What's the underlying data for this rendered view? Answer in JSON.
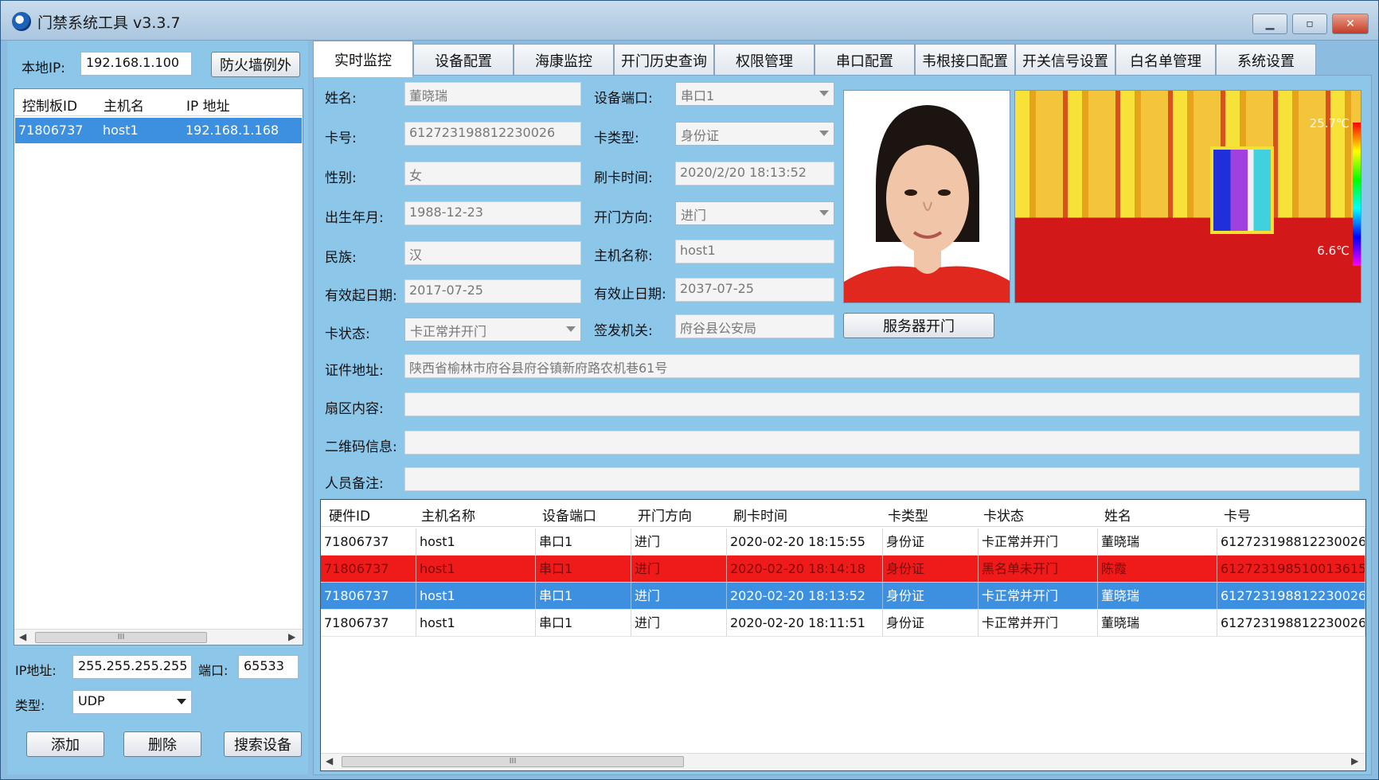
{
  "window": {
    "title": "门禁系统工具 v3.3.7",
    "minimize_icon": "minimize-icon",
    "maximize_icon": "maximize-icon",
    "close_icon": "close-icon"
  },
  "left": {
    "local_ip_label": "本地IP:",
    "local_ip_value": "192.168.1.100",
    "firewall_button": "防火墙例外",
    "device_list": {
      "headers": [
        "控制板ID",
        "主机名",
        "IP 地址"
      ],
      "rows": [
        {
          "id": "71806737",
          "host": "host1",
          "ip": "192.168.1.168"
        }
      ]
    },
    "ip_label": "IP地址:",
    "ip_value": "255.255.255.255",
    "port_label": "端口:",
    "port_value": "65533",
    "type_label": "类型:",
    "type_value": "UDP",
    "add_button": "添加",
    "delete_button": "删除",
    "search_button": "搜索设备"
  },
  "tabs": [
    "实时监控",
    "设备配置",
    "海康监控",
    "开门历史查询",
    "权限管理",
    "串口配置",
    "韦根接口配置",
    "开关信号设置",
    "白名单管理",
    "系统设置"
  ],
  "active_tab": "实时监控",
  "form": {
    "name_label": "姓名:",
    "name_value": "董晓瑞",
    "device_port_label": "设备端口:",
    "device_port_value": "串口1",
    "card_label": "卡号:",
    "card_value": "612723198812230026",
    "card_type_label": "卡类型:",
    "card_type_value": "身份证",
    "gender_label": "性别:",
    "gender_value": "女",
    "swipe_time_label": "刷卡时间:",
    "swipe_time_value": "2020/2/20 18:13:52",
    "birth_label": "出生年月:",
    "birth_value": "1988-12-23",
    "direction_label": "开门方向:",
    "direction_value": "进门",
    "ethnic_label": "民族:",
    "ethnic_value": "汉",
    "host_label": "主机名称:",
    "host_value": "host1",
    "valid_from_label": "有效起日期:",
    "valid_from_value": "2017-07-25",
    "valid_to_label": "有效止日期:",
    "valid_to_value": "2037-07-25",
    "card_status_label": "卡状态:",
    "card_status_value": "卡正常并开门",
    "issuer_label": "签发机关:",
    "issuer_value": "府谷县公安局",
    "server_open_button": "服务器开门",
    "address_label": "证件地址:",
    "address_value": "陕西省榆林市府谷县府谷镇新府路农机巷61号",
    "sector_label": "扇区内容:",
    "sector_value": "",
    "qr_label": "二维码信息:",
    "qr_value": "",
    "note_label": "人员备注:",
    "note_value": ""
  },
  "thermal": {
    "max_temp": "25.7℃",
    "min_temp": "6.6℃"
  },
  "records": {
    "headers": [
      "硬件ID",
      "主机名称",
      "设备端口",
      "开门方向",
      "刷卡时间",
      "卡类型",
      "卡状态",
      "姓名",
      "卡号"
    ],
    "rows": [
      {
        "hw": "71806737",
        "host": "host1",
        "port": "串口1",
        "dir": "进门",
        "time": "2020-02-20 18:15:55",
        "type": "身份证",
        "status": "卡正常并开门",
        "name": "董晓瑞",
        "card": "612723198812230026"
      },
      {
        "hw": "71806737",
        "host": "host1",
        "port": "串口1",
        "dir": "进门",
        "time": "2020-02-20 18:14:18",
        "type": "身份证",
        "status": "黑名单未开门",
        "name": "陈霞",
        "card": "612723198510013615"
      },
      {
        "hw": "71806737",
        "host": "host1",
        "port": "串口1",
        "dir": "进门",
        "time": "2020-02-20 18:13:52",
        "type": "身份证",
        "status": "卡正常并开门",
        "name": "董晓瑞",
        "card": "612723198812230026"
      },
      {
        "hw": "71806737",
        "host": "host1",
        "port": "串口1",
        "dir": "进门",
        "time": "2020-02-20 18:11:51",
        "type": "身份证",
        "status": "卡正常并开门",
        "name": "董晓瑞",
        "card": "612723198812230026"
      }
    ]
  },
  "scroll_thumb": "III",
  "colors": {
    "panel_bg": "#8cc7ea",
    "selected_row": "#3d8fe0",
    "blacklist_row": "#ef1b1b"
  }
}
